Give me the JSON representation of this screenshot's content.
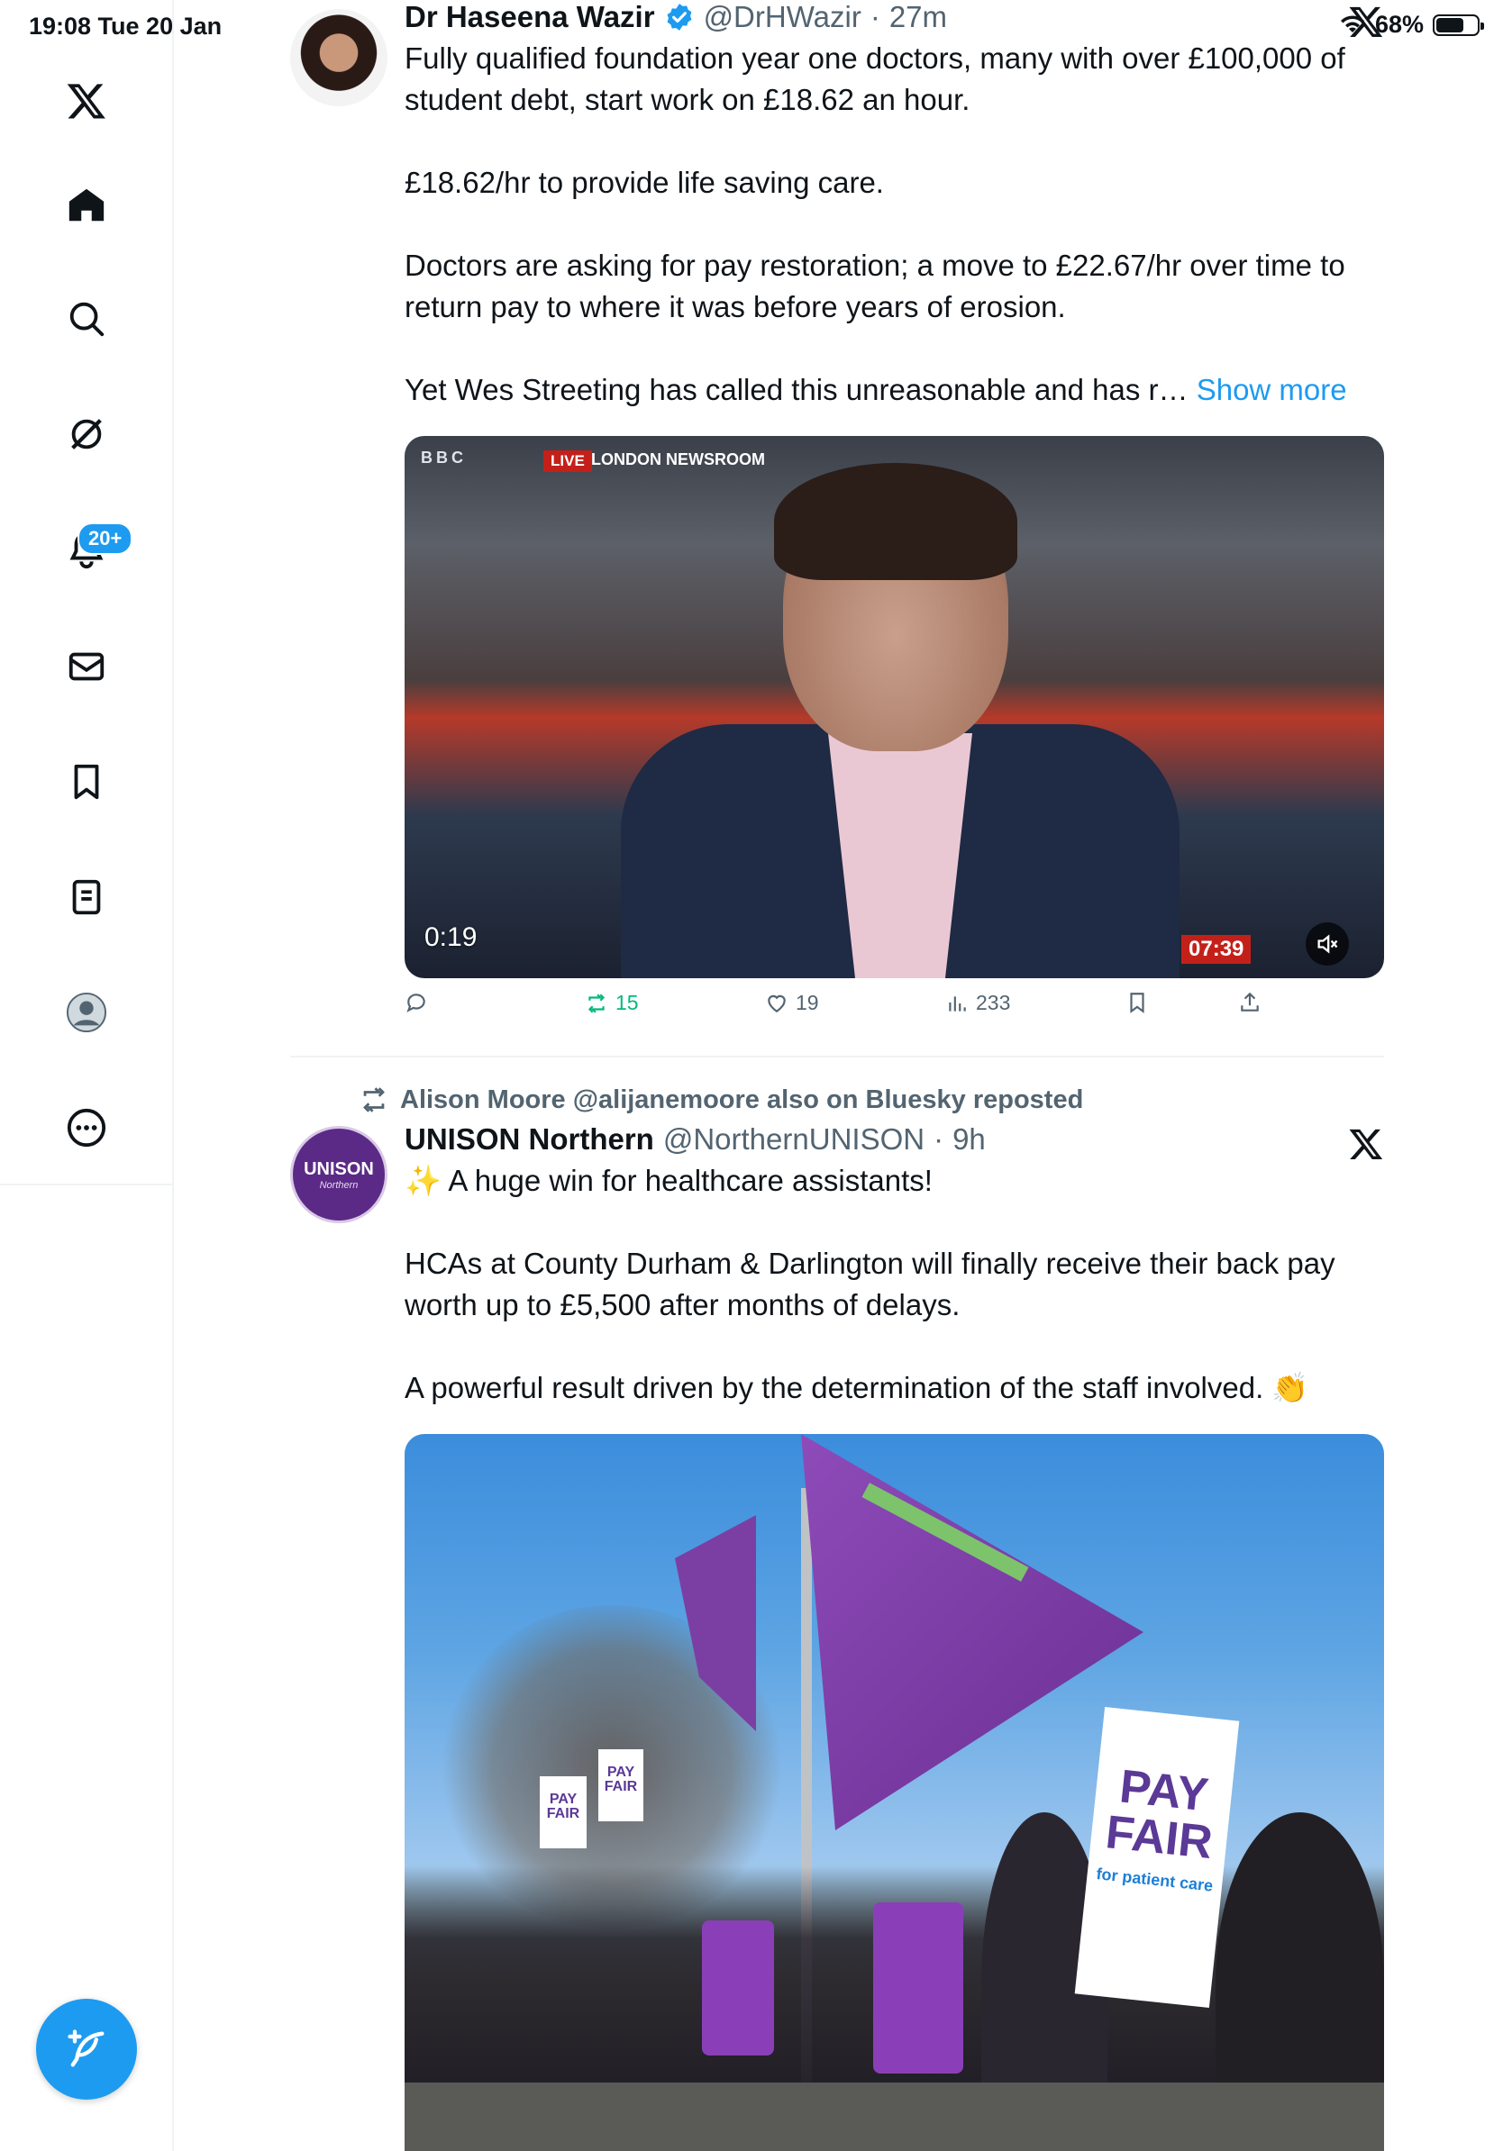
{
  "status": {
    "time": "19:08  Tue 20 Jan",
    "battery": "68%",
    "battery_level": 0.68
  },
  "sidebar": {
    "items": [
      {
        "name": "x-logo",
        "icon": "x-logo"
      },
      {
        "name": "home",
        "icon": "home-icon"
      },
      {
        "name": "explore",
        "icon": "search-icon"
      },
      {
        "name": "grok",
        "icon": "grok-icon"
      },
      {
        "name": "notifications",
        "icon": "bell-icon",
        "badge": "20+"
      },
      {
        "name": "messages",
        "icon": "mail-icon"
      },
      {
        "name": "bookmarks",
        "icon": "bookmark-icon"
      },
      {
        "name": "lists",
        "icon": "list-icon"
      },
      {
        "name": "profile",
        "icon": "avatar-icon"
      },
      {
        "name": "more",
        "icon": "more-icon"
      }
    ],
    "compose_icon": "compose-icon"
  },
  "tweet1": {
    "name": "Dr Haseena Wazir",
    "handle": "@DrHWazir",
    "dot": "·",
    "time": "27m",
    "paragraphs": [
      "Fully qualified foundation year one doctors, many with over £100,000 of student debt, start work on £18.62 an hour.",
      "£18.62/hr to provide life saving care.",
      "Doctors are asking for pay restoration; a move to £22.67/hr over time to return pay to where it was before years of erosion."
    ],
    "truncated": "Yet Wes Streeting has called this unreasonable and has r…",
    "show_more": "Show more",
    "video": {
      "bbc": "BBC",
      "live": "LIVE",
      "newsroom": "LONDON NEWSROOM",
      "elapsed": "0:19",
      "clock": "07:39"
    },
    "actions": {
      "replies": "",
      "reposts": "15",
      "likes": "19",
      "views": "233"
    }
  },
  "tweet2": {
    "repost_by": "Alison Moore @alijanemoore also on Bluesky reposted",
    "name": "UNISON Northern",
    "handle": "@NorthernUNISON",
    "dot": "·",
    "time": "9h",
    "avatar_text": "UNISON",
    "avatar_sub": "Northern",
    "paragraphs": [
      "✨ A huge win for healthcare assistants!",
      "HCAs at County Durham & Darlington will finally receive their back pay worth up to £5,500 after months of delays.",
      "A powerful result driven by the determination of the staff involved. 👏"
    ],
    "photo": {
      "sign_big": "PAY FAIR",
      "sign_big_sub": "for patient care",
      "sign_small": "PAY FAIR"
    }
  },
  "colors": {
    "accent": "#1d9bf0",
    "repost_green": "#00ba7c",
    "unison_purple": "#5b2a86"
  }
}
